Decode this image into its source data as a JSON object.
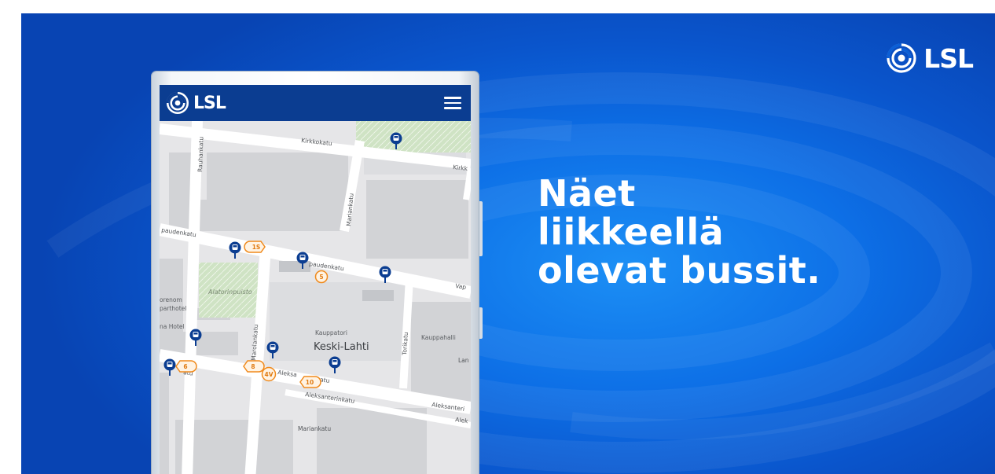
{
  "brand": {
    "name": "LSL",
    "logo_icon": "lsl-logo-icon"
  },
  "headline": {
    "line1": "Näet",
    "line2": "liikkeellä",
    "line3": "olevat bussit."
  },
  "phone_app": {
    "header_logo_text": "LSL",
    "menu_icon": "hamburger-menu-icon",
    "map": {
      "street_labels": {
        "kirkkokatu": "Kirkkokatu",
        "kirkk_edge": "Kirkk",
        "rauhankatu": "Rauhankatu",
        "vapaudenkatu_left": "paudenkatu",
        "vapaudenkatu_mid": "paudenkatu",
        "vapaudenkatu_right": "Vap",
        "mariankatu_top": "Mariankatu",
        "marolankatu": "Marolankatu",
        "torikatu": "Torikatu",
        "aleksanterinkatu_left": "atu",
        "aleksanterinkatu_mid": "Aleksa",
        "aleksanterinkatu_mid2": "nkatu",
        "aleksanterinkatu_low": "Aleksanterinkatu",
        "aleksanterinkatu_right": "Aleksanteri",
        "alek_edge": "Alek",
        "mariankatu_bottom": "Mariankatu",
        "lan_edge": "Lan"
      },
      "poi_labels": {
        "alatorinpuisto": "Alatorinpuisto",
        "kauppatori": "Kauppatori",
        "keski_lahti": "Keski-Lahti",
        "kauppahalli": "Kauppahalli",
        "orenom": "orenom",
        "parthotel": "parthotel",
        "na_hotel": "na Hotel"
      },
      "route_badges": [
        "1S",
        "5",
        "6",
        "8",
        "4V",
        "10"
      ],
      "bus_icon": "bus-stop-pin-icon",
      "colors": {
        "badge_orange": "#f08a1c",
        "bus_blue": "#0b3d91",
        "park_green": "#cfe3c4"
      }
    }
  },
  "colors": {
    "background_blue": "#0d6fe6",
    "app_header": "#0b3d91"
  }
}
